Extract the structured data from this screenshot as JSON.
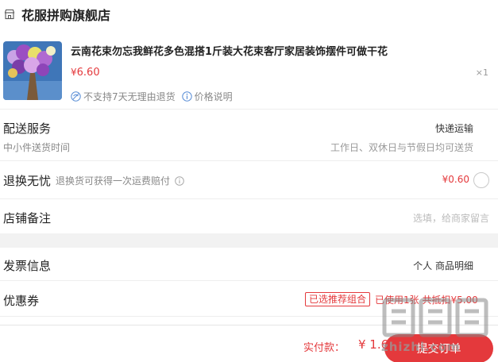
{
  "store": {
    "name": "花服拼购旗舰店"
  },
  "product": {
    "title": "云南花束勿忘我鲜花多色混搭1斤装大花束客厅家居装饰摆件可做干花",
    "price": "6.60",
    "currency": "¥",
    "quantity": "×1",
    "tags": [
      "不支持7天无理由退货",
      "价格说明"
    ]
  },
  "delivery": {
    "label": "配送服务",
    "sub": "中小件送货时间",
    "method": "快递运输",
    "time": "工作日、双休日与节假日均可送货"
  },
  "returns": {
    "label": "退换无忧",
    "desc": "退换货可获得一次运费赔付",
    "fee": "¥0.60"
  },
  "remark": {
    "label": "店铺备注",
    "hint": "选填，给商家留言"
  },
  "invoice": {
    "label": "发票信息",
    "value": "个人 商品明细"
  },
  "coupon": {
    "label": "优惠券",
    "badge": "已选推荐组合",
    "used": "已使用1张 共抵扣¥5.00"
  },
  "footer": {
    "total_label": "实付款：",
    "total": "¥ 1.60",
    "submit": "提交订单"
  },
  "watermark": {
    "text": "zhizhi.com"
  },
  "colors": {
    "accent": "#e4393c",
    "divider": "#eeeeee",
    "muted": "#888888"
  }
}
